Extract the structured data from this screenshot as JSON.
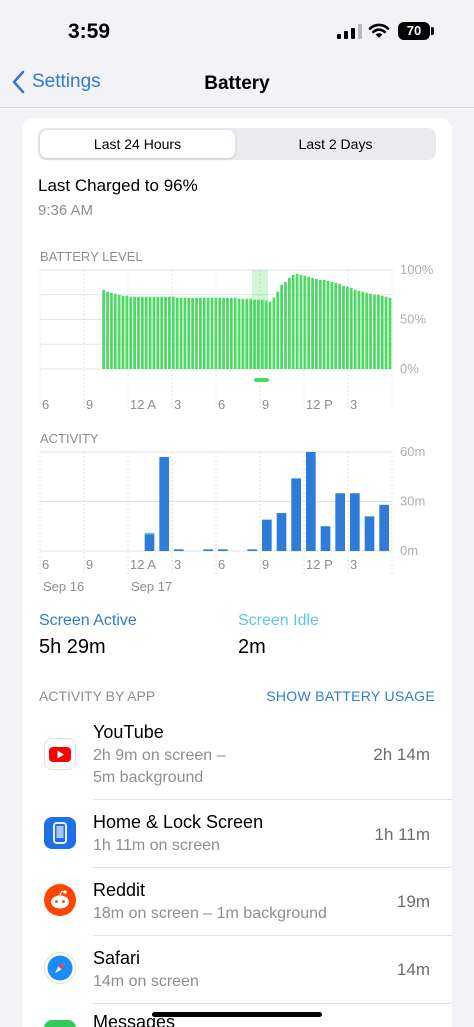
{
  "status": {
    "time": "3:59",
    "battery": "70"
  },
  "nav": {
    "back_label": "Settings",
    "title": "Battery"
  },
  "segment": {
    "options": [
      "Last 24 Hours",
      "Last 2 Days"
    ],
    "selected": "Last 24 Hours"
  },
  "last_charged": {
    "label": "Last Charged to 96%",
    "time": "9:36 AM"
  },
  "battery_section": "BATTERY LEVEL",
  "activity_section": "ACTIVITY",
  "dates": [
    "Sep 16",
    "Sep 17"
  ],
  "screen": {
    "active_label": "Screen Active",
    "active_value": "5h 29m",
    "idle_label": "Screen Idle",
    "idle_value": "2m",
    "active_color": "#2f7bd9",
    "idle_color": "#5ac8e8"
  },
  "apps_header": {
    "title": "ACTIVITY BY APP",
    "action": "SHOW BATTERY USAGE"
  },
  "apps": [
    {
      "name": "YouTube",
      "detail": [
        "2h 9m on screen –",
        "5m background"
      ],
      "time": "2h 14m",
      "icon": "youtube-icon",
      "color": "#ffffff"
    },
    {
      "name": "Home & Lock Screen",
      "detail": [
        "1h 11m on screen"
      ],
      "time": "1h 11m",
      "icon": "home-lock-screen-icon",
      "color": "#1f6fe8"
    },
    {
      "name": "Reddit",
      "detail": [
        "18m on screen – 1m background"
      ],
      "time": "19m",
      "icon": "reddit-icon",
      "color": "#ff4500"
    },
    {
      "name": "Safari",
      "detail": [
        "14m on screen"
      ],
      "time": "14m",
      "icon": "safari-icon",
      "color": "#ffffff"
    },
    {
      "name": "Messages",
      "detail": [],
      "time": "",
      "icon": "messages-icon",
      "color": "#34c759"
    }
  ],
  "chart_data": [
    {
      "type": "bar",
      "title": "BATTERY LEVEL",
      "x_tick_labels": [
        "6",
        "9",
        "12 A",
        "3",
        "6",
        "9",
        "12 P",
        "3"
      ],
      "y_tick_labels": [
        "100%",
        "50%",
        "0%"
      ],
      "ylim": [
        0,
        100
      ],
      "color": "#4cd964",
      "charging_color": "#4cd964",
      "grid": true,
      "values": [
        0,
        0,
        0,
        0,
        0,
        0,
        0,
        0,
        0,
        0,
        0,
        0,
        0,
        0,
        0,
        0,
        80,
        78,
        77,
        76,
        75,
        74,
        74,
        73,
        73,
        73,
        73,
        73,
        73,
        73,
        73,
        73,
        73,
        73,
        73,
        72,
        72,
        72,
        72,
        72,
        72,
        72,
        72,
        72,
        72,
        72,
        72,
        72,
        72,
        72,
        72,
        71,
        71,
        71,
        71,
        70,
        70,
        70,
        69,
        68,
        72,
        78,
        85,
        88,
        92,
        95,
        96,
        95,
        94,
        93,
        92,
        91,
        90,
        90,
        89,
        88,
        87,
        86,
        84,
        83,
        82,
        80,
        79,
        78,
        77,
        76,
        75,
        75,
        74,
        73,
        72
      ],
      "charging_range": [
        9,
        11
      ]
    },
    {
      "type": "bar",
      "title": "ACTIVITY",
      "x_tick_labels": [
        "6",
        "9",
        "12 A",
        "3",
        "6",
        "9",
        "12 P",
        "3"
      ],
      "y_tick_labels": [
        "60m",
        "30m",
        "0m"
      ],
      "ylim": [
        0,
        60
      ],
      "color": "#2f7bd9",
      "idle_color": "#5ac8e8",
      "grid": true,
      "hours": [
        6,
        7,
        8,
        9,
        10,
        11,
        12,
        13,
        14,
        15,
        16,
        17,
        18,
        19,
        20,
        21,
        22,
        23
      ],
      "series": [
        {
          "name": "Screen Active",
          "values": [
            0,
            0,
            0,
            0,
            10,
            57,
            1,
            0,
            1,
            1,
            0,
            1,
            19,
            23,
            44,
            60,
            15,
            35,
            35,
            21,
            28
          ]
        },
        {
          "name": "Screen Idle",
          "values": [
            0,
            0,
            0,
            0,
            1,
            0,
            0,
            0,
            0,
            0,
            0,
            0,
            0,
            0,
            0,
            0,
            0,
            0,
            0,
            0,
            0
          ]
        }
      ]
    }
  ]
}
